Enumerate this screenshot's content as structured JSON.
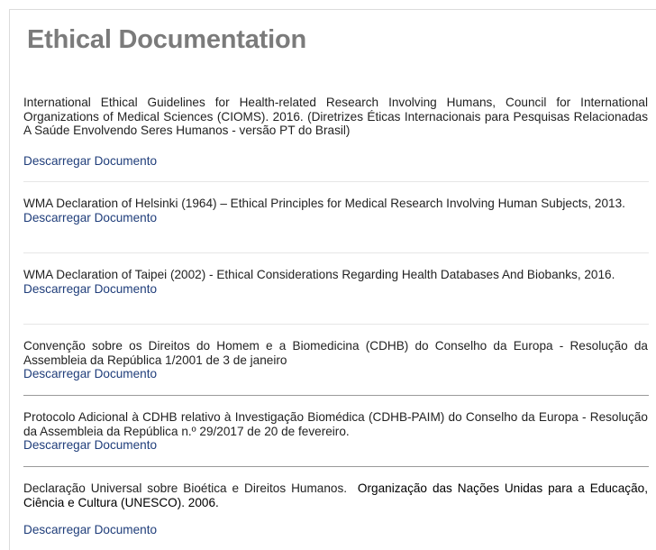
{
  "page": {
    "title": "Ethical Documentation"
  },
  "documents": [
    {
      "text": "International Ethical Guidelines for Health-related Research Involving Humans, Council for International Organizations of Medical Sciences (CIOMS). 2016. (Diretrizes Éticas Internacionais para Pesquisas Relacionadas A Saúde Envolvendo Seres Humanos - versão PT do Brasil)",
      "link": "Descarregar Documento"
    },
    {
      "text": "WMA Declaration of Helsinki (1964) – Ethical Principles for Medical Research Involving Human Subjects, 2013.",
      "link": "Descarregar Documento"
    },
    {
      "text": "WMA Declaration of Taipei (2002) - Ethical Considerations Regarding Health Databases And Biobanks, 2016.",
      "link": "Descarregar Documento"
    },
    {
      "text": "Convenção sobre os Direitos do Homem e a Biomedicina (CDHB) do Conselho da Europa - Resolução da Assembleia da República 1/2001 de 3 de janeiro",
      "link": "Descarregar Documento"
    },
    {
      "text": "Protocolo Adicional à CDHB relativo à Investigação Biomédica (CDHB-PAIM) do Conselho da Europa - Resolução da Assembleia da República n.º 29/2017 de 20 de fevereiro.",
      "link": "Descarregar Documento"
    },
    {
      "text_part1": "Declaração Universal sobre Bioética e Direitos Humanos.",
      "text_part2": "Organização das Nações Unidas para a Educação, Ciência e Cultura (UNESCO). 2006.",
      "link": "Descarregar Documento"
    }
  ]
}
